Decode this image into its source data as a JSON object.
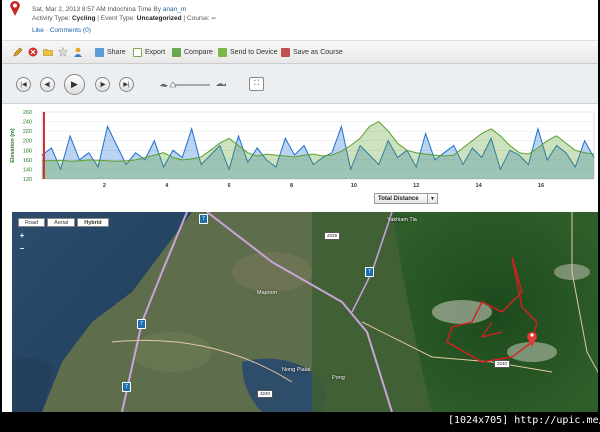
{
  "header": {
    "date_text": "Sat, Mar 2, 2013 8:57 AM Indochina Time By ",
    "user": "anan_m",
    "activity_label": "Activity Type: ",
    "activity_value": "Cycling",
    "event_label": " | Event Type: ",
    "event_value": "Uncategorized",
    "course_label": " | Course: ",
    "course_value": "--",
    "like": "Like",
    "comments": "Comments (0)",
    "separator": " · "
  },
  "toolbar": {
    "share": "Share",
    "export": "Export",
    "compare": "Compare",
    "send": "Send to Device",
    "save_course": "Save as Course",
    "icons": [
      "pencil-icon",
      "delete-icon",
      "folder-icon",
      "star-icon",
      "user-icon"
    ]
  },
  "player": {
    "buttons": [
      "skip-start",
      "step-back",
      "play",
      "step-forward",
      "skip-end"
    ]
  },
  "chart_data": {
    "type": "area",
    "ylabel": "Elevation (m)",
    "ylim": [
      120,
      260
    ],
    "yticks": [
      120,
      140,
      160,
      180,
      200,
      220,
      240,
      260
    ],
    "xticks": [
      2,
      4,
      6,
      8,
      10,
      12,
      14,
      16
    ],
    "xlim": [
      0,
      17.7
    ],
    "x_axis_selector": "Total Distance",
    "series": [
      {
        "kind": "speed_overlay",
        "color": "#1f6fd1",
        "values": [
          170,
          185,
          140,
          210,
          160,
          175,
          145,
          230,
          190,
          150,
          175,
          160,
          200,
          145,
          180,
          165,
          225,
          150,
          170,
          190,
          140,
          210,
          155,
          185,
          160,
          145,
          205,
          170,
          190,
          150,
          165,
          175,
          230,
          140,
          190,
          170,
          150,
          200,
          165,
          180,
          145,
          215,
          160,
          175,
          190,
          150,
          185,
          165,
          205,
          140,
          180,
          170,
          150,
          225,
          160,
          190,
          175,
          145,
          200,
          165
        ]
      },
      {
        "kind": "elevation",
        "color": "#5aa02c",
        "values": [
          158,
          158,
          159,
          157,
          158,
          160,
          159,
          158,
          157,
          158,
          160,
          165,
          170,
          175,
          165,
          160,
          162,
          166,
          180,
          195,
          205,
          190,
          175,
          168,
          172,
          170,
          168,
          166,
          170,
          172,
          168,
          170,
          178,
          190,
          205,
          230,
          240,
          220,
          195,
          180,
          175,
          172,
          170,
          168,
          170,
          185,
          200,
          215,
          225,
          210,
          190,
          175,
          172,
          185,
          200,
          210,
          195,
          180,
          175,
          172
        ]
      }
    ]
  },
  "map": {
    "types": [
      "Road",
      "Aerial",
      "Hybrid"
    ],
    "selected": "Hybrid",
    "zoom_in": "+",
    "zoom_out": "−",
    "labels": [
      "Yakhiam Tia",
      "Mapoon",
      "Nong Plalai",
      "Pong"
    ],
    "roads": [
      "2029",
      "3240",
      "3240"
    ],
    "highway_shields": [
      "7",
      "7",
      "7",
      "7"
    ],
    "track_color": "#d42020"
  },
  "watermark": "[1024x705] http://upic.me/"
}
